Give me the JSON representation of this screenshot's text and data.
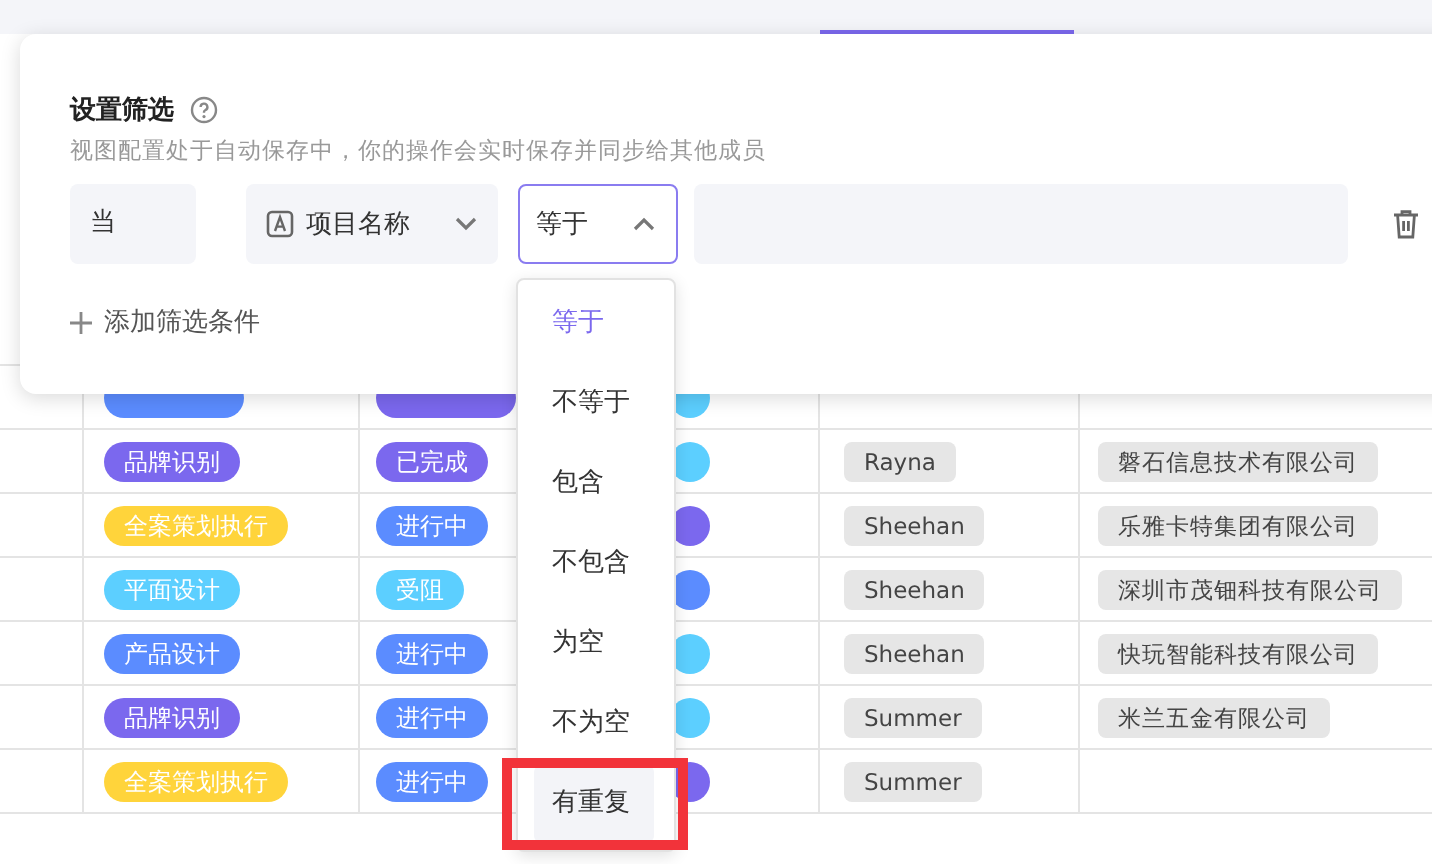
{
  "table": {
    "rows": [
      {
        "category": {
          "color": "#5b8cff"
        },
        "status": {
          "color": "#7b68ee"
        },
        "dot": {
          "color": "#5ccfff"
        }
      },
      {
        "category": {
          "label": "品牌识别",
          "color": "#7b68ee"
        },
        "status": {
          "label": "已完成",
          "color": "#7b68ee"
        },
        "dot": {
          "color": "#5ccfff"
        },
        "owner": "Rayna",
        "company": "磐石信息技术有限公司"
      },
      {
        "category": {
          "label": "全案策划执行",
          "color": "#ffd43b"
        },
        "status": {
          "label": "进行中",
          "color": "#5b8cff"
        },
        "dot": {
          "color": "#7b68ee"
        },
        "owner": "Sheehan",
        "company": "乐雅卡特集团有限公司"
      },
      {
        "category": {
          "label": "平面设计",
          "color": "#5ccfff"
        },
        "status": {
          "label": "受阻",
          "color": "#5ccfff"
        },
        "dot": {
          "color": "#5b8cff"
        },
        "owner": "Sheehan",
        "company": "深圳市茂钿科技有限公司"
      },
      {
        "category": {
          "label": "产品设计",
          "color": "#5b8cff"
        },
        "status": {
          "label": "进行中",
          "color": "#5b8cff"
        },
        "dot": {
          "color": "#5ccfff"
        },
        "owner": "Sheehan",
        "company": "快玩智能科技有限公司"
      },
      {
        "category": {
          "label": "品牌识别",
          "color": "#7b68ee"
        },
        "status": {
          "label": "进行中",
          "color": "#5b8cff"
        },
        "dot": {
          "color": "#5ccfff"
        },
        "owner": "Summer",
        "company": "米兰五金有限公司"
      },
      {
        "category": {
          "label": "全案策划执行",
          "color": "#ffd43b"
        },
        "status": {
          "label": "进行中",
          "color": "#5b8cff"
        },
        "dot": {
          "color": "#7b68ee"
        },
        "owner": "Summer"
      }
    ]
  },
  "filter_panel": {
    "title": "设置筛选",
    "subtitle": "视图配置处于自动保存中，你的操作会实时保存并同步给其他成员",
    "condition": {
      "prefix": "当",
      "field": "项目名称",
      "operator": "等于",
      "operator_open": true
    },
    "add_label": "添加筛选条件"
  },
  "operator_menu": [
    {
      "label": "等于",
      "selected": true,
      "highlighted": false
    },
    {
      "label": "不等于",
      "selected": false,
      "highlighted": false
    },
    {
      "label": "包含",
      "selected": false,
      "highlighted": false
    },
    {
      "label": "不包含",
      "selected": false,
      "highlighted": false
    },
    {
      "label": "为空",
      "selected": false,
      "highlighted": false
    },
    {
      "label": "不为空",
      "selected": false,
      "highlighted": false
    },
    {
      "label": "有重复",
      "selected": false,
      "highlighted": true
    }
  ]
}
